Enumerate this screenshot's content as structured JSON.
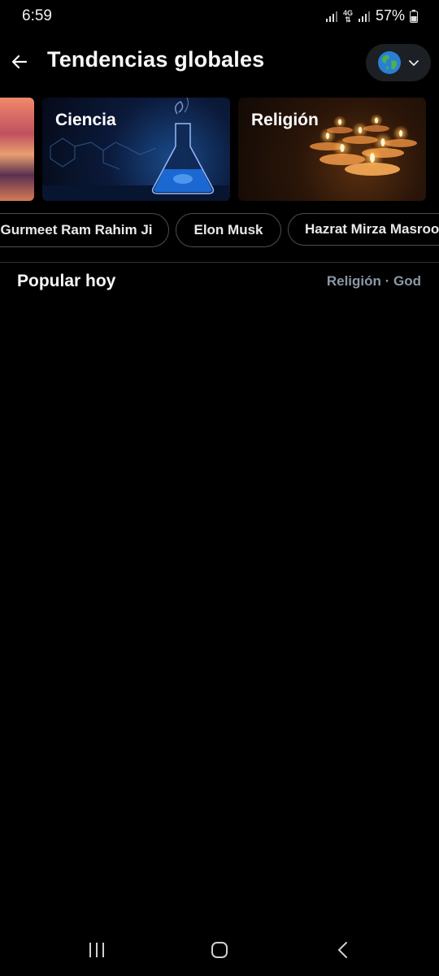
{
  "status": {
    "time": "6:59",
    "network": "4G",
    "battery": "57%"
  },
  "header": {
    "title": "Tendencias globales",
    "region_icon": "globe-icon"
  },
  "categories": [
    {
      "label": ""
    },
    {
      "label": "Ciencia"
    },
    {
      "label": "Religión"
    }
  ],
  "pills": [
    {
      "label": "Gurmeet Ram Rahim Ji"
    },
    {
      "label": "Elon Musk"
    },
    {
      "label": "Hazrat Mirza Masroor"
    }
  ],
  "section": {
    "title": "Popular hoy",
    "meta": "Religión · God"
  },
  "colors": {
    "background": "#000000",
    "text": "#e7e9ea",
    "muted": "#8b98a5",
    "border": "#2f3336"
  }
}
